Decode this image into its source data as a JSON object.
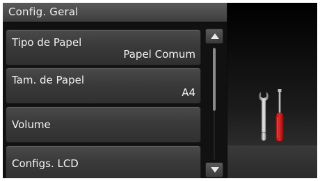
{
  "header": {
    "title": "Config. Geral"
  },
  "menu": {
    "items": [
      {
        "label": "Tipo de Papel",
        "value": "Papel Comum"
      },
      {
        "label": "Tam. de Papel",
        "value": "A4"
      },
      {
        "label": "Volume"
      },
      {
        "label": "Configs. LCD"
      }
    ]
  },
  "scroll": {
    "position": 0.0
  },
  "icons": {
    "settings": "wrench-screwdriver-icon"
  },
  "colors": {
    "screwdriver_handle": "#c81a1a",
    "text": "#f2f2f2"
  }
}
